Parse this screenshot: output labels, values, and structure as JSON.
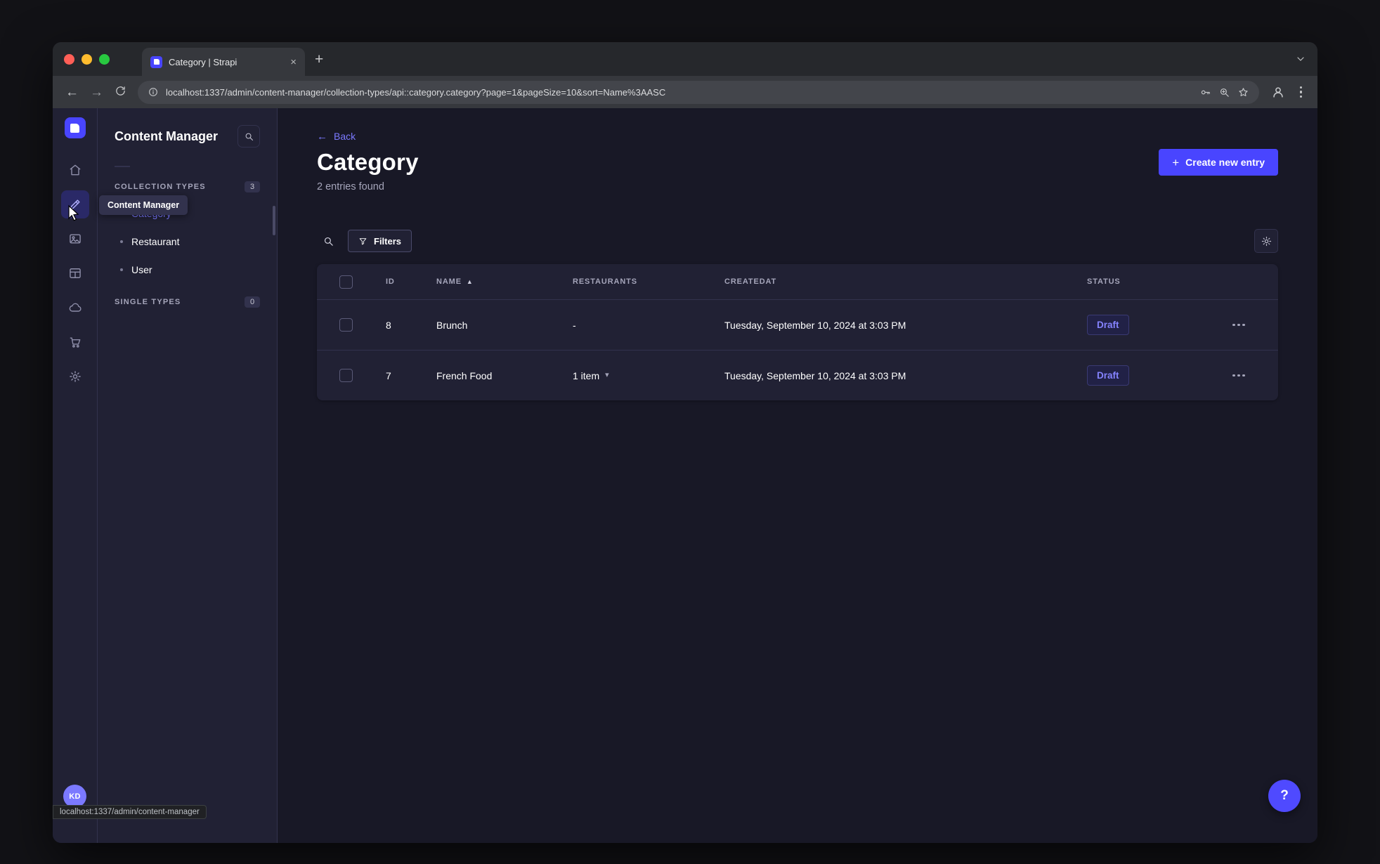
{
  "chrome": {
    "tab_title": "Category | Strapi",
    "url": "localhost:1337/admin/content-manager/collection-types/api::category.category?page=1&pageSize=10&sort=Name%3AASC"
  },
  "glyphs": {
    "close": "×",
    "plus": "+",
    "back_arrow": "←",
    "forward_arrow": "→",
    "sort_asc": "▲",
    "chevron_down": "▾",
    "question": "?"
  },
  "rail": {
    "avatar_initials": "KD",
    "icons": [
      "strapi-logo",
      "home-icon",
      "content-manager-pen-icon",
      "media-library-icon",
      "content-type-builder-icon",
      "cloud-icon",
      "marketplace-cart-icon",
      "settings-gear-icon"
    ]
  },
  "tooltip": {
    "text": "Content Manager"
  },
  "status_bubble": {
    "text": "localhost:1337/admin/content-manager"
  },
  "subnav": {
    "title": "Content Manager",
    "collection_types": {
      "label": "COLLECTION TYPES",
      "badge": "3",
      "items": [
        {
          "label": "Category",
          "active": true
        },
        {
          "label": "Restaurant",
          "active": false
        },
        {
          "label": "User",
          "active": false
        }
      ]
    },
    "single_types": {
      "label": "SINGLE TYPES",
      "badge": "0"
    }
  },
  "main": {
    "back": "Back",
    "title": "Category",
    "subtitle": "2 entries found",
    "create_button": "Create new entry",
    "filters": "Filters",
    "table": {
      "headers": {
        "id": "ID",
        "name": "NAME",
        "restaurants": "RESTAURANTS",
        "createdat": "CREATEDAT",
        "status": "STATUS"
      },
      "rows": [
        {
          "id": "8",
          "name": "Brunch",
          "restaurants": "-",
          "createdat": "Tuesday, September 10, 2024 at 3:03 PM",
          "status": "Draft"
        },
        {
          "id": "7",
          "name": "French Food",
          "restaurants": "1 item",
          "createdat": "Tuesday, September 10, 2024 at 3:03 PM",
          "status": "Draft"
        }
      ]
    }
  },
  "colors": {
    "primary": "#4945ff",
    "primary_light": "#7b79ff",
    "app_background": "#181826",
    "panel_background": "#212134",
    "border": "#32324d",
    "text_muted": "#a5a5ba",
    "status_draft_text": "#8583ff"
  }
}
